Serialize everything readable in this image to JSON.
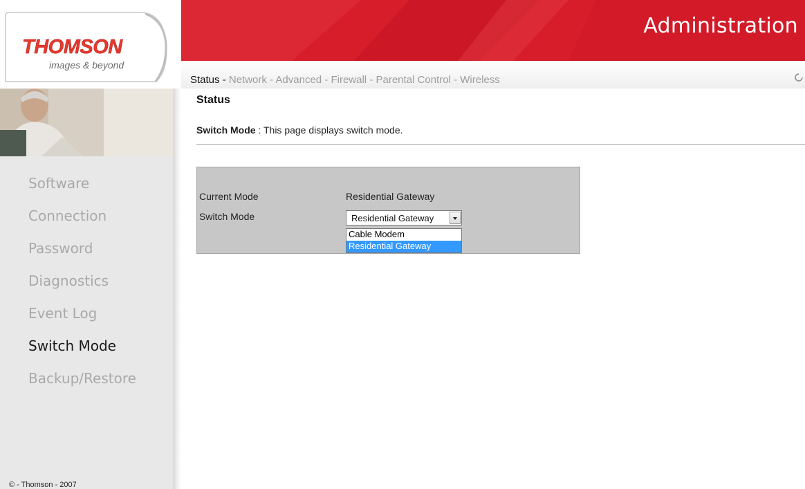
{
  "brand": {
    "logo_text": "THOMSON",
    "tagline": "images & beyond",
    "accent_color": "#d91f2c"
  },
  "header": {
    "title": "Administration"
  },
  "tabs": [
    {
      "label": "Status",
      "active": true
    },
    {
      "label": "Network",
      "active": false
    },
    {
      "label": "Advanced",
      "active": false
    },
    {
      "label": "Firewall",
      "active": false
    },
    {
      "label": "Parental Control",
      "active": false
    },
    {
      "label": "Wireless",
      "active": false
    }
  ],
  "tab_separator": " - ",
  "sidebar": {
    "items": [
      {
        "label": "Software",
        "active": false
      },
      {
        "label": "Connection",
        "active": false
      },
      {
        "label": "Password",
        "active": false
      },
      {
        "label": "Diagnostics",
        "active": false
      },
      {
        "label": "Event Log",
        "active": false
      },
      {
        "label": "Switch Mode",
        "active": true
      },
      {
        "label": "Backup/Restore",
        "active": false
      }
    ],
    "copyright": "© - Thomson - 2007"
  },
  "main": {
    "title": "Status",
    "desc_label": "Switch Mode",
    "desc_sep": " : ",
    "desc_text": "This page displays switch mode.",
    "current_mode_label": "Current Mode",
    "current_mode_value": "Residential Gateway",
    "switch_mode_label": "Switch Mode",
    "switch_mode_selected": "Residential Gateway",
    "switch_mode_options": [
      "Cable Modem",
      "Residential Gateway"
    ]
  }
}
